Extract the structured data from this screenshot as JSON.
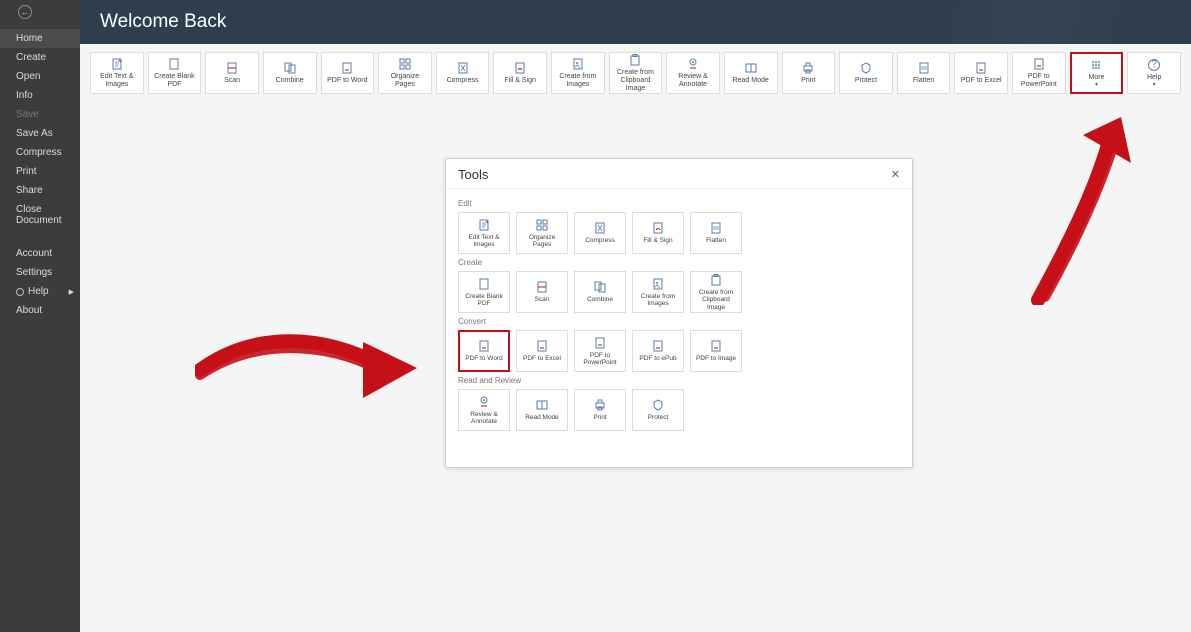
{
  "sidebar": {
    "items": [
      {
        "label": "Home",
        "active": true
      },
      {
        "label": "Create"
      },
      {
        "label": "Open"
      },
      {
        "label": "Info"
      },
      {
        "label": "Save",
        "disabled": true
      },
      {
        "label": "Save As"
      },
      {
        "label": "Compress"
      },
      {
        "label": "Print"
      },
      {
        "label": "Share"
      },
      {
        "label": "Close Document"
      },
      {
        "label": "Account"
      },
      {
        "label": "Settings"
      },
      {
        "label": "Help",
        "hasArrow": true
      },
      {
        "label": "About"
      }
    ]
  },
  "header": {
    "title": "Welcome Back"
  },
  "toolbar": [
    {
      "label": "Edit Text & Images",
      "icon": "edit"
    },
    {
      "label": "Create Blank PDF",
      "icon": "blank"
    },
    {
      "label": "Scan",
      "icon": "scan"
    },
    {
      "label": "Combine",
      "icon": "combine"
    },
    {
      "label": "PDF to Word",
      "icon": "doc"
    },
    {
      "label": "Organize Pages",
      "icon": "organize"
    },
    {
      "label": "Compress",
      "icon": "compress"
    },
    {
      "label": "Fill & Sign",
      "icon": "sign"
    },
    {
      "label": "Create from Images",
      "icon": "fromimg"
    },
    {
      "label": "Create from Clipboard Image",
      "icon": "clipboard"
    },
    {
      "label": "Review & Annotate",
      "icon": "review"
    },
    {
      "label": "Read Mode",
      "icon": "read"
    },
    {
      "label": "Print",
      "icon": "print"
    },
    {
      "label": "Protect",
      "icon": "protect"
    },
    {
      "label": "Flatten",
      "icon": "flatten"
    },
    {
      "label": "PDF to Excel",
      "icon": "doc"
    },
    {
      "label": "PDF to PowerPoint",
      "icon": "doc"
    },
    {
      "label": "More",
      "icon": "more",
      "highlight": true,
      "chevron": true
    },
    {
      "label": "Help",
      "icon": "help",
      "chevron": true
    }
  ],
  "modal": {
    "title": "Tools",
    "sections": [
      {
        "title": "Edit",
        "tiles": [
          {
            "label": "Edit Text & Images",
            "icon": "edit"
          },
          {
            "label": "Organize Pages",
            "icon": "organize"
          },
          {
            "label": "Compress",
            "icon": "compress"
          },
          {
            "label": "Fill & Sign",
            "icon": "sign"
          },
          {
            "label": "Flatten",
            "icon": "flatten"
          }
        ]
      },
      {
        "title": "Create",
        "tiles": [
          {
            "label": "Create Blank PDF",
            "icon": "blank"
          },
          {
            "label": "Scan",
            "icon": "scan"
          },
          {
            "label": "Combine",
            "icon": "combine"
          },
          {
            "label": "Create from Images",
            "icon": "fromimg"
          },
          {
            "label": "Create from Clipboard Image",
            "icon": "clipboard"
          }
        ]
      },
      {
        "title": "Convert",
        "tiles": [
          {
            "label": "PDF to Word",
            "icon": "doc",
            "highlight": true
          },
          {
            "label": "PDF to Excel",
            "icon": "doc"
          },
          {
            "label": "PDF to PowerPoint",
            "icon": "doc"
          },
          {
            "label": "PDF to ePub",
            "icon": "doc"
          },
          {
            "label": "PDF to Image",
            "icon": "doc"
          }
        ]
      },
      {
        "title": "Read and Review",
        "tiles": [
          {
            "label": "Review & Annotate",
            "icon": "review"
          },
          {
            "label": "Read Mode",
            "icon": "read"
          },
          {
            "label": "Print",
            "icon": "print"
          },
          {
            "label": "Protect",
            "icon": "protect"
          }
        ]
      }
    ]
  }
}
